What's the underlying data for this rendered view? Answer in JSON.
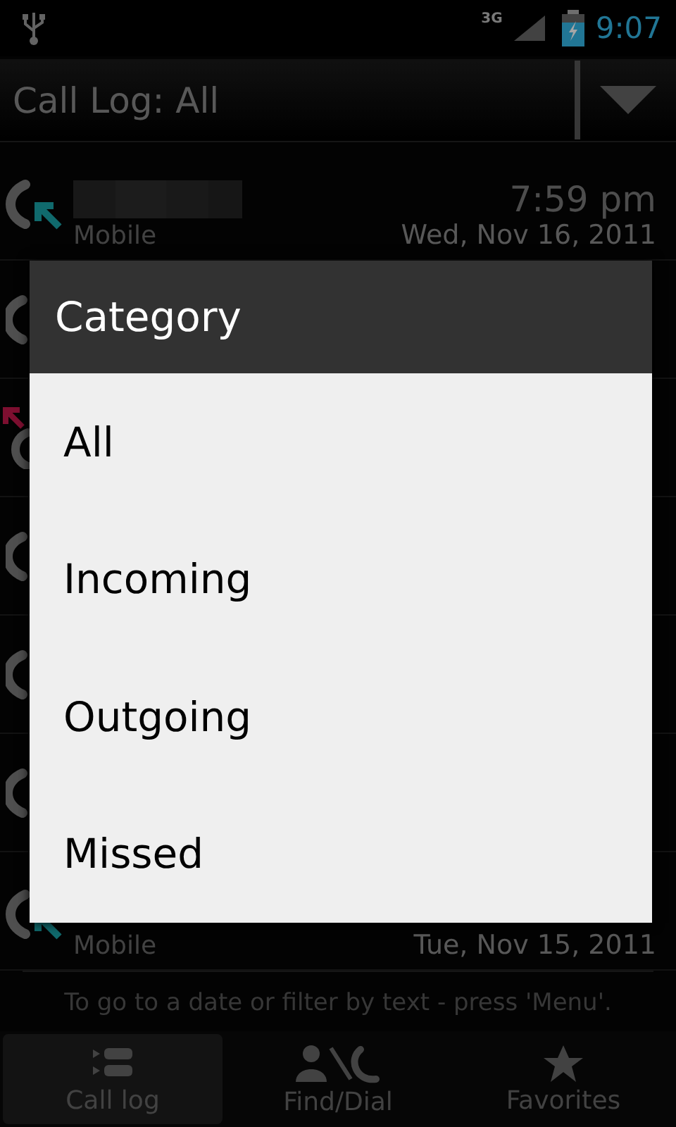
{
  "status_bar": {
    "network": "3G",
    "time": "9:07"
  },
  "title_bar": {
    "title": "Call Log: All"
  },
  "calls": [
    {
      "kind": "incoming",
      "redacted": true,
      "time": "7:59 pm",
      "label": "Mobile",
      "date": "Wed, Nov 16, 2011"
    },
    {
      "kind": "plain"
    },
    {
      "kind": "missed"
    },
    {
      "kind": "plain"
    },
    {
      "kind": "plain"
    },
    {
      "kind": "plain"
    },
    {
      "kind": "incoming",
      "label": "Mobile",
      "date": "Tue, Nov 15, 2011"
    }
  ],
  "dialog": {
    "title": "Category",
    "options": [
      "All",
      "Incoming",
      "Outgoing",
      "Missed"
    ]
  },
  "hint": "To go to a date or filter by text - press 'Menu'.",
  "tabs": [
    {
      "label": "Call log",
      "selected": true
    },
    {
      "label": "Find/Dial",
      "selected": false
    },
    {
      "label": "Favorites",
      "selected": false
    }
  ]
}
